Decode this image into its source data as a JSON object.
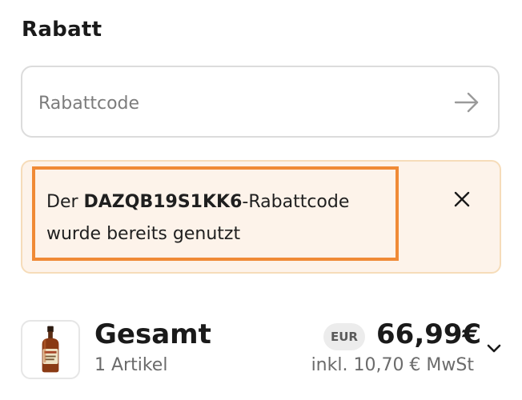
{
  "discount": {
    "heading": "Rabatt",
    "input_placeholder": "Rabattcode",
    "input_value": "",
    "submit_icon": "arrow-right-icon"
  },
  "alert": {
    "prefix": "Der ",
    "code": "DAZQB19S1KK6",
    "suffix_line1": "-Rabattcode",
    "line2": "wurde bereits genutzt",
    "close_icon": "close-icon",
    "background_color": "#fdf3ea",
    "border_color": "#f6dcb9",
    "highlight_color": "#f08a36"
  },
  "summary": {
    "total_label": "Gesamt",
    "item_count": "1 Artikel",
    "currency": "EUR",
    "total_amount": "66,99€",
    "tax_note": "inkl. 10,70 € MwSt",
    "expand_icon": "chevron-down-icon",
    "product_image": "bottle-image"
  }
}
